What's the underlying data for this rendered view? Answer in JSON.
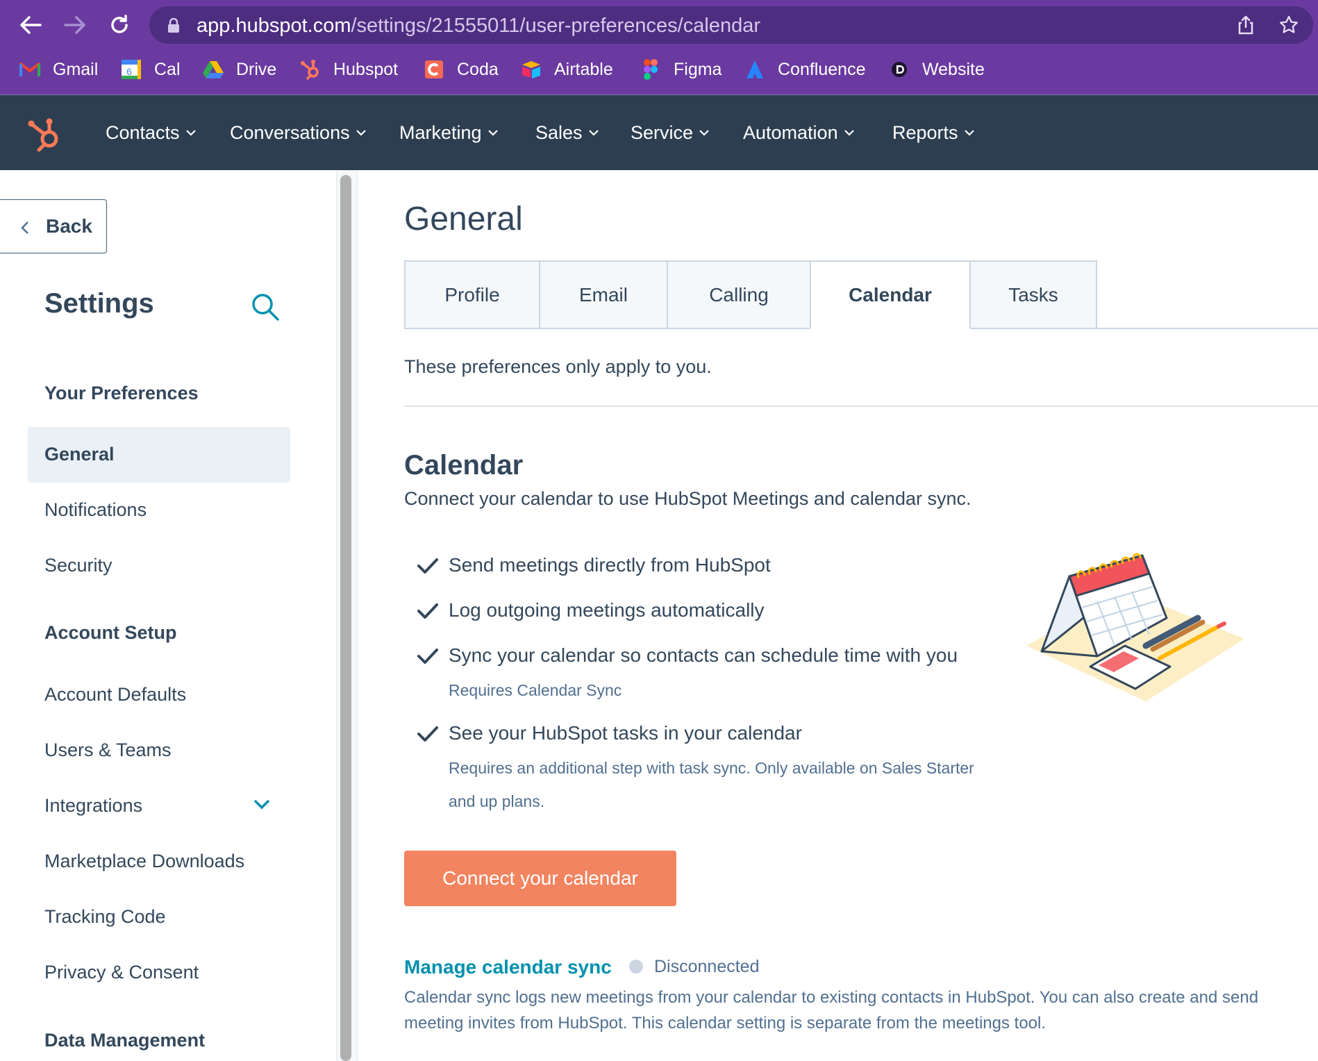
{
  "browser": {
    "url_host": "app.hubspot.com",
    "url_path": "/settings/21555011/user-preferences/calendar",
    "bookmarks": [
      {
        "label": "Gmail",
        "icon": "gmail-icon"
      },
      {
        "label": "Cal",
        "icon": "calendar-icon"
      },
      {
        "label": "Drive",
        "icon": "drive-icon"
      },
      {
        "label": "Hubspot",
        "icon": "hubspot-icon"
      },
      {
        "label": "Coda",
        "icon": "coda-icon"
      },
      {
        "label": "Airtable",
        "icon": "airtable-icon"
      },
      {
        "label": "Figma",
        "icon": "figma-icon"
      },
      {
        "label": "Confluence",
        "icon": "confluence-icon"
      },
      {
        "label": "Website",
        "icon": "website-icon"
      }
    ],
    "cal_icon_text": "6"
  },
  "topnav": {
    "items": [
      "Contacts",
      "Conversations",
      "Marketing",
      "Sales",
      "Service",
      "Automation",
      "Reports"
    ]
  },
  "sidebar": {
    "back_label": "Back",
    "title": "Settings",
    "sections": {
      "preferences": "Your Preferences",
      "account_setup": "Account Setup",
      "data_management": "Data Management"
    },
    "pref_items": [
      "General",
      "Notifications",
      "Security"
    ],
    "account_items": [
      "Account Defaults",
      "Users & Teams",
      "Integrations",
      "Marketplace Downloads",
      "Tracking Code",
      "Privacy & Consent"
    ]
  },
  "main": {
    "title": "General",
    "tabs": [
      "Profile",
      "Email",
      "Calling",
      "Calendar",
      "Tasks"
    ],
    "active_tab": "Calendar",
    "pref_note": "These preferences only apply to you.",
    "calendar_title": "Calendar",
    "calendar_subtitle": "Connect your calendar to use HubSpot Meetings and calendar sync.",
    "features": [
      {
        "text": "Send meetings directly from HubSpot",
        "note": ""
      },
      {
        "text": "Log outgoing meetings automatically",
        "note": ""
      },
      {
        "text": "Sync your calendar so contacts can schedule time with you",
        "note": "Requires Calendar Sync"
      },
      {
        "text": "See your HubSpot tasks in your calendar",
        "note": "Requires an additional step with task sync. Only available on Sales Starter and up plans."
      }
    ],
    "connect_button": "Connect your calendar",
    "sync_link": "Manage calendar sync",
    "sync_status": "Disconnected",
    "sync_description": "Calendar sync logs new meetings from your calendar to existing contacts in HubSpot. You can also create and send meeting invites from HubSpot. This calendar setting is separate from the meetings tool."
  },
  "colors": {
    "browser_purple": "#6a3aa0",
    "nav_dark": "#2d3e50",
    "accent_orange": "#f2845f",
    "link_teal": "#0091ae",
    "text_dark": "#33475b"
  }
}
